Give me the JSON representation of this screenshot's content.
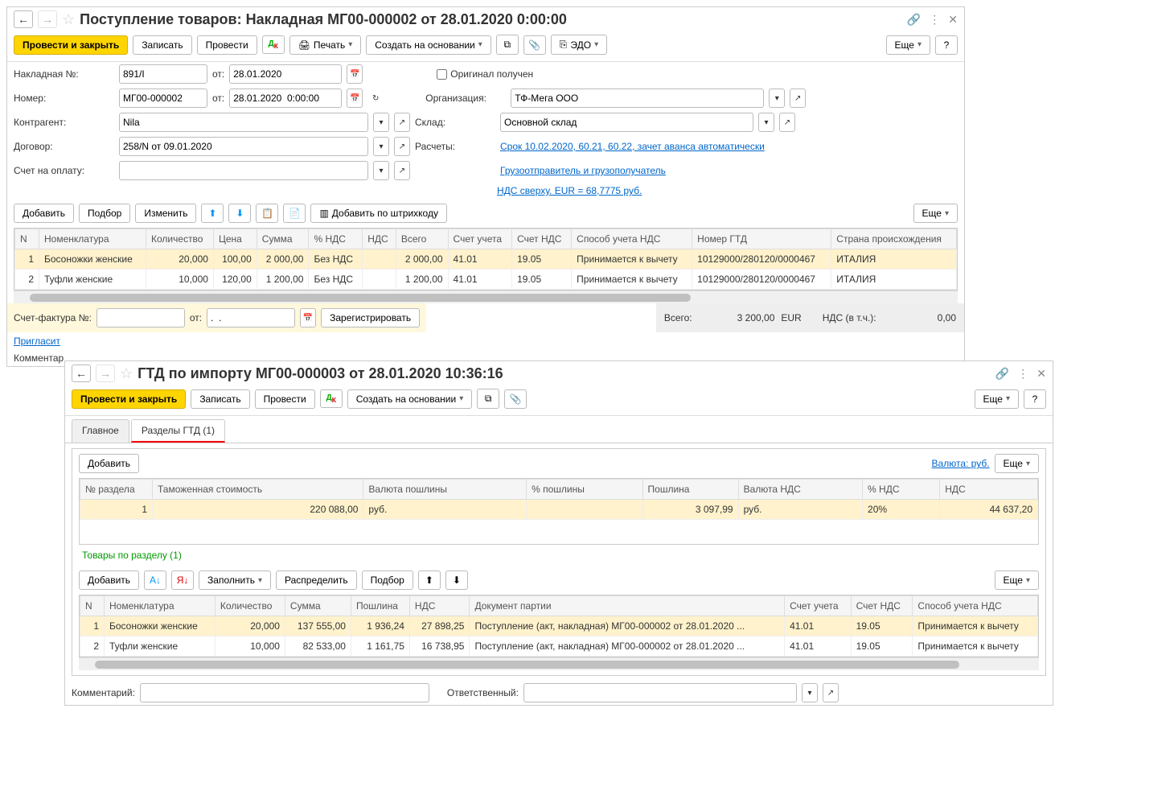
{
  "win1": {
    "title": "Поступление товаров: Накладная МГ00-000002 от 28.01.2020 0:00:00",
    "toolbar": {
      "post_close": "Провести и закрыть",
      "write": "Записать",
      "post": "Провести",
      "print": "Печать",
      "create_from": "Создать на основании",
      "edo": "ЭДО",
      "more": "Еще"
    },
    "form": {
      "invoice_label": "Накладная №:",
      "invoice_no": "891/I",
      "from_label": "от:",
      "invoice_date": "28.01.2020",
      "original_label": "Оригинал получен",
      "number_label": "Номер:",
      "number": "МГ00-000002",
      "number_date": "28.01.2020  0:00:00",
      "contractor_label": "Контрагент:",
      "contractor": "Nila",
      "org_label": "Организация:",
      "org": "ТФ-Мега ООО",
      "warehouse_label": "Склад:",
      "warehouse": "Основной склад",
      "contract_label": "Договор:",
      "contract": "258/N от 09.01.2020",
      "calc_label": "Расчеты:",
      "calc_link": "Срок 10.02.2020, 60.21, 60.22, зачет аванса автоматически",
      "pay_account_label": "Счет на оплату:",
      "shipper_link": "Грузоотправитель и грузополучатель",
      "vat_link": "НДС сверху.  EUR = 68,7775 руб."
    },
    "tabletb": {
      "add": "Добавить",
      "pick": "Подбор",
      "edit": "Изменить",
      "barcode": "Добавить по штрихкоду",
      "more": "Еще"
    },
    "cols": {
      "n": "N",
      "nom": "Номенклатура",
      "qty": "Количество",
      "price": "Цена",
      "sum": "Сумма",
      "vat_pct": "% НДС",
      "vat": "НДС",
      "total": "Всего",
      "acc": "Счет учета",
      "vat_acc": "Счет НДС",
      "vat_method": "Способ учета НДС",
      "gtd": "Номер ГТД",
      "country": "Страна происхождения"
    },
    "rows": [
      {
        "n": "1",
        "nom": "Босоножки женские",
        "qty": "20,000",
        "price": "100,00",
        "sum": "2 000,00",
        "vat_pct": "Без НДС",
        "vat": "",
        "total": "2 000,00",
        "acc": "41.01",
        "vat_acc": "19.05",
        "vat_method": "Принимается к вычету",
        "gtd": "10129000/280120/0000467",
        "country": "ИТАЛИЯ"
      },
      {
        "n": "2",
        "nom": "Туфли женские",
        "qty": "10,000",
        "price": "120,00",
        "sum": "1 200,00",
        "vat_pct": "Без НДС",
        "vat": "",
        "total": "1 200,00",
        "acc": "41.01",
        "vat_acc": "19.05",
        "vat_method": "Принимается к вычету",
        "gtd": "10129000/280120/0000467",
        "country": "ИТАЛИЯ"
      }
    ],
    "sf": {
      "label": "Счет-фактура №:",
      "from": "от:",
      "date_placeholder": ".  .",
      "register": "Зарегистрировать"
    },
    "totals": {
      "total_label": "Всего:",
      "total": "3 200,00",
      "currency": "EUR",
      "vat_label": "НДС (в т.ч.):",
      "vat": "0,00"
    },
    "invite": "Пригласит",
    "comment_label": "Комментар"
  },
  "win2": {
    "title": "ГТД по импорту МГ00-000003 от 28.01.2020 10:36:16",
    "toolbar": {
      "post_close": "Провести и закрыть",
      "write": "Записать",
      "post": "Провести",
      "create_from": "Создать на основании",
      "more": "Еще"
    },
    "tabs": {
      "main": "Главное",
      "sections": "Разделы ГТД (1)"
    },
    "sectb": {
      "add": "Добавить",
      "currency": "Валюта: руб.",
      "more": "Еще"
    },
    "seccols": {
      "secno": "№ раздела",
      "customs": "Таможенная стоимость",
      "duty_cur": "Валюта пошлины",
      "duty_pct": "% пошлины",
      "duty": "Пошлина",
      "vat_cur": "Валюта НДС",
      "vat_pct": "% НДС",
      "vat": "НДС"
    },
    "secrows": [
      {
        "secno": "1",
        "customs": "220 088,00",
        "duty_cur": "руб.",
        "duty_pct": "",
        "duty": "3 097,99",
        "vat_cur": "руб.",
        "vat_pct": "20%",
        "vat": "44 637,20"
      }
    ],
    "goods_title": "Товары по разделу (1)",
    "goodstb": {
      "add": "Добавить",
      "fill": "Заполнить",
      "distribute": "Распределить",
      "pick": "Подбор",
      "more": "Еще"
    },
    "goodscols": {
      "n": "N",
      "nom": "Номенклатура",
      "qty": "Количество",
      "sum": "Сумма",
      "duty": "Пошлина",
      "vat": "НДС",
      "batch": "Документ партии",
      "acc": "Счет учета",
      "vat_acc": "Счет НДС",
      "vat_method": "Способ учета НДС"
    },
    "goodsrows": [
      {
        "n": "1",
        "nom": "Босоножки женские",
        "qty": "20,000",
        "sum": "137 555,00",
        "duty": "1 936,24",
        "vat": "27 898,25",
        "batch": "Поступление (акт, накладная) МГ00-000002 от 28.01.2020 ...",
        "acc": "41.01",
        "vat_acc": "19.05",
        "vat_method": "Принимается к вычету"
      },
      {
        "n": "2",
        "nom": "Туфли женские",
        "qty": "10,000",
        "sum": "82 533,00",
        "duty": "1 161,75",
        "vat": "16 738,95",
        "batch": "Поступление (акт, накладная) МГ00-000002 от 28.01.2020 ...",
        "acc": "41.01",
        "vat_acc": "19.05",
        "vat_method": "Принимается к вычету"
      }
    ],
    "footer": {
      "comment": "Комментарий:",
      "responsible": "Ответственный:"
    }
  }
}
